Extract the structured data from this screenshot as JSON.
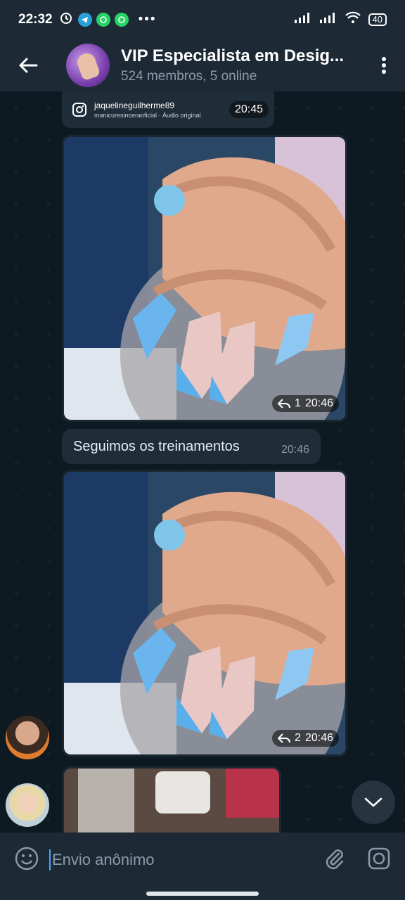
{
  "status_bar": {
    "time": "22:32",
    "dots": "•••",
    "battery": "40"
  },
  "header": {
    "back_icon": "arrow-left-icon",
    "title": "VIP Especialista em Desig...",
    "subtitle": "524 membros, 5 online",
    "menu_icon": "more-vertical-icon"
  },
  "messages": [
    {
      "type": "instagram-reel",
      "username": "jaquelineguilherme89",
      "audio": "manicuresinceraoficial · Áudio original",
      "time": "20:45"
    },
    {
      "type": "photo",
      "replies": "1",
      "time": "20:46"
    },
    {
      "type": "text",
      "text": "Seguimos os treinamentos",
      "time": "20:46"
    },
    {
      "type": "photo",
      "replies": "2",
      "time": "20:46"
    }
  ],
  "input": {
    "placeholder": "Envio anônimo"
  },
  "colors": {
    "header": "#1d2a35",
    "chat_bg": "#0e1a21",
    "bubble": "#1f2d38",
    "accent": "#4aa3ff"
  }
}
